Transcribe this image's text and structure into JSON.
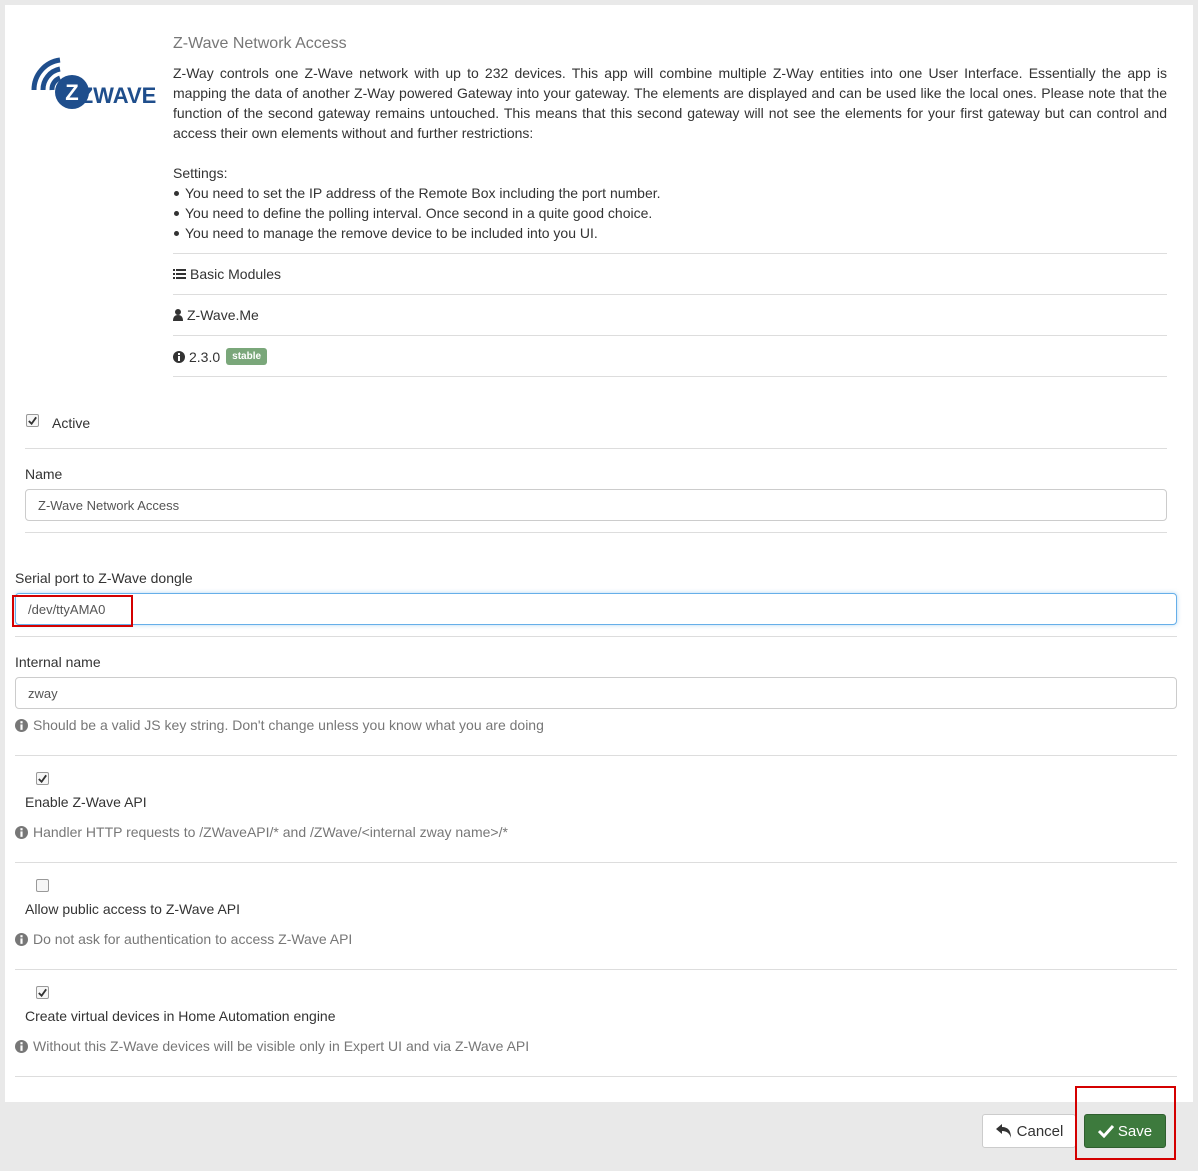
{
  "app": {
    "title": "Z-Wave Network Access",
    "logo_text": "ZWAVE",
    "description": "Z-Way controls one Z-Wave network with up to 232 devices. This app will combine multiple Z-Way entities into one User Interface. Essentially the app is mapping the data of another Z-Way powered Gateway into your gateway. The elements are displayed and can be used like the local ones. Please note that the function of the second gateway remains untouched. This means that this second gateway will not see the elements for your first gateway but can control and access their own elements without and further restrictions:",
    "settings_heading": "Settings:",
    "settings_items": [
      "You need to set the IP address of the Remote Box including the port number.",
      "You need to define the polling interval. Once second in a quite good choice.",
      "You need to manage the remove device to be included into you UI."
    ],
    "category": "Basic Modules",
    "author": "Z-Wave.Me",
    "version": "2.3.0",
    "badge": "stable"
  },
  "form": {
    "active_label": "Active",
    "active_checked": true,
    "name_label": "Name",
    "name_value": "Z-Wave Network Access",
    "serial_label": "Serial port to Z-Wave dongle",
    "serial_value": "/dev/ttyAMA0",
    "internal_label": "Internal name",
    "internal_value": "zway",
    "internal_help": "Should be a valid JS key string. Don't change unless you know what you are doing",
    "enable_api_label": "Enable Z-Wave API",
    "enable_api_checked": true,
    "enable_api_help": "Handler HTTP requests to /ZWaveAPI/* and /ZWave/<internal zway name>/*",
    "public_label": "Allow public access to Z-Wave API",
    "public_checked": false,
    "public_help": "Do not ask for authentication to access Z-Wave API",
    "virtual_label": "Create virtual devices in Home Automation engine",
    "virtual_checked": true,
    "virtual_help": "Without this Z-Wave devices will be visible only in Expert UI and via Z-Wave API"
  },
  "footer": {
    "cancel_label": "Cancel",
    "save_label": "Save"
  },
  "colors": {
    "save_button": "#3d7a3d",
    "badge": "#7aa77a",
    "highlight": "#d40000",
    "logo": "#1f4e8c"
  }
}
